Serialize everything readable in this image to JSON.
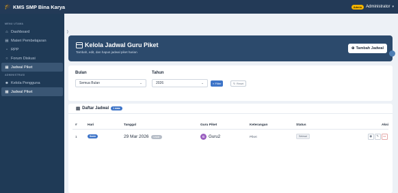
{
  "app": {
    "title": "KMS SMP Bina Karya",
    "admin_badge": "Admin",
    "user_name": "Administrator"
  },
  "sidebar": {
    "sections": [
      "MENU UTAMA",
      "ADMINISTRASI"
    ],
    "main_items": [
      {
        "label": "Dashboard",
        "icon": "home-icon"
      },
      {
        "label": "Materi Pembelajaran",
        "icon": "book-icon"
      },
      {
        "label": "RPP",
        "icon": "document-icon"
      },
      {
        "label": "Forum Diskusi",
        "icon": "chat-icon"
      },
      {
        "label": "Jadwal Piket",
        "icon": "calendar-icon"
      }
    ],
    "admin_items": [
      {
        "label": "Kelola Pengguna",
        "icon": "users-icon"
      },
      {
        "label": "Jadwal Piket",
        "icon": "calendar-icon"
      }
    ]
  },
  "breadcrumb": ")",
  "header": {
    "title": "Kelola Jadwal Guru Piket",
    "subtitle": "Tambah, edit, dan hapus jadwal piket harian",
    "add_button": "Tambah Jadwal"
  },
  "filter": {
    "month_label": "Bulan",
    "month_value": "Semua Bulan",
    "year_label": "Tahun",
    "year_value": "2026",
    "filter_button": "Filter",
    "reset_button": "Reset"
  },
  "table": {
    "title": "Daftar Jadwal",
    "count_badge": "1 data",
    "columns": [
      "#",
      "Hari",
      "Tanggal",
      "Guru Piket",
      "Keterangan",
      "Status",
      "Aksi"
    ],
    "rows": [
      {
        "no": "1",
        "hari": "Senin",
        "tanggal": "29 Mar 2026",
        "tanggal_badge": "Lewat",
        "guru_initial": "G",
        "guru": "Guru2",
        "keterangan": "Piket",
        "status": "Selesai"
      }
    ]
  },
  "colors": {
    "navbar": "#233a57",
    "sidebar": "#1f3a56",
    "hero": "#2c4a6c",
    "accent": "#3d74c8",
    "admin_badge": "#f2b300",
    "avatar": "#9b5fc0",
    "danger": "#d24a4a"
  }
}
